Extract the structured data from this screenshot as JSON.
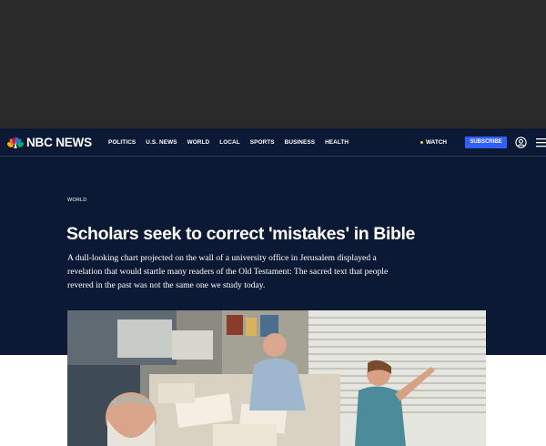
{
  "brand": {
    "name": "NBC NEWS",
    "peacock_colors": [
      "#fcb711",
      "#f37021",
      "#cc004c",
      "#6460aa",
      "#0089d0",
      "#0db14b"
    ]
  },
  "nav": {
    "links": [
      "POLITICS",
      "U.S. NEWS",
      "WORLD",
      "LOCAL",
      "SPORTS",
      "BUSINESS",
      "HEALTH"
    ],
    "watch_label": "WATCH",
    "subscribe_label": "SUBSCRIBE",
    "account_icon": "account-icon",
    "menu_icon": "hamburger-menu-icon"
  },
  "article": {
    "section": "WORLD",
    "headline": "Scholars seek to correct 'mistakes' in Bible",
    "dek": "A dull-looking chart projected on the wall of a university office in Jerusalem displayed a revelation that would startle many readers of the Old Testament: The sacred text that people revered in the past was not the same one we study today."
  },
  "colors": {
    "navbar_bg": "#0b1934",
    "ad_bg": "#2a2a2a",
    "subscribe_bg": "#3061ff",
    "watch_dot": "#ffcc4d"
  }
}
